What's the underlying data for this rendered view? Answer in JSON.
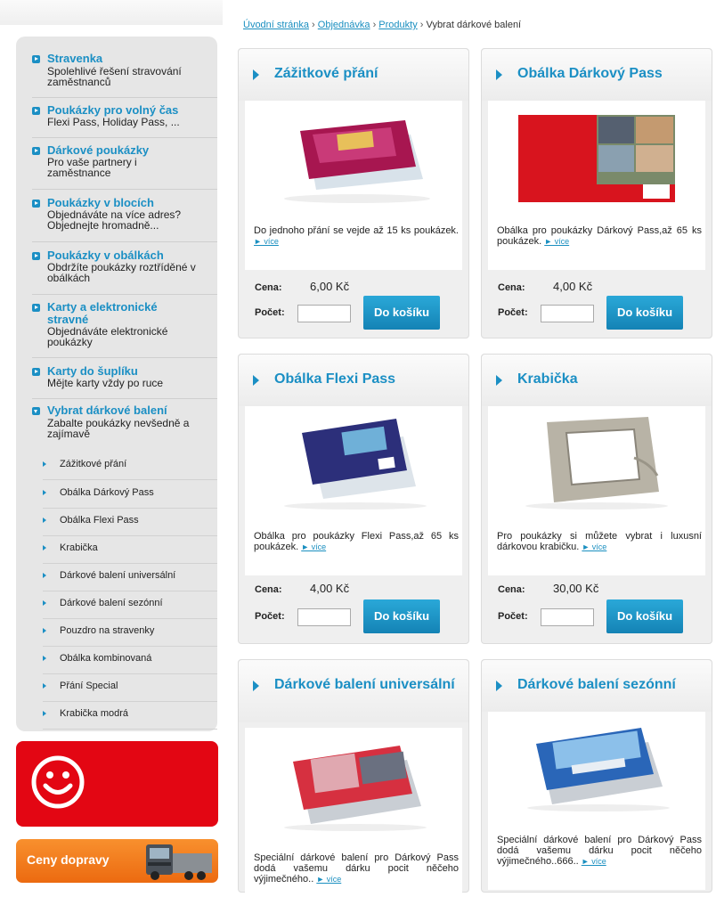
{
  "breadcrumb": {
    "home": "Úvodní stránka",
    "order": "Objednávka",
    "products": "Produkty",
    "current": "Vybrat dárkové balení",
    "sep": "›"
  },
  "sidebar": {
    "items": [
      {
        "title": "Stravenka",
        "desc": "Spolehlivé řešení stravování zaměstnanců"
      },
      {
        "title": "Poukázky pro volný čas",
        "desc": "Flexi Pass, Holiday Pass, ..."
      },
      {
        "title": "Dárkové poukázky",
        "desc": "Pro vaše partnery i zaměstnance"
      },
      {
        "title": "Poukázky v blocích",
        "desc": "Objednáváte na více adres? Objednejte hromadně..."
      },
      {
        "title": "Poukázky v obálkách",
        "desc": "Obdržíte poukázky roztříděné v obálkách"
      },
      {
        "title": "Karty a elektronické stravné",
        "desc": "Objednáváte elektronické poukázky"
      },
      {
        "title": "Karty do šuplíku",
        "desc": "Mějte karty vždy po ruce"
      },
      {
        "title": "Vybrat dárkové balení",
        "desc": "Zabalte poukázky nevšedně a zajímavě"
      }
    ],
    "subitems": [
      "Zážitkové přání",
      "Obálka Dárkový Pass",
      "Obálka Flexi Pass",
      "Krabička",
      "Dárkové balení universální",
      "Dárkové balení sezónní",
      "Pouzdro na stravenky",
      "Obálka kombinovaná",
      "Přání Special",
      "Krabička modrá"
    ],
    "shipping_label": "Ceny dopravy"
  },
  "labels": {
    "price": "Cena:",
    "qty": "Počet:",
    "add_to_cart": "Do košíku",
    "more": "► více"
  },
  "products": [
    {
      "title": "Zážitkové přání",
      "desc": "Do jednoho přání se vejde až 15 ks poukázek.",
      "price": "6,00 Kč"
    },
    {
      "title": "Obálka Dárkový Pass",
      "desc": "Obálka pro poukázky Dárkový Pass,až 65 ks poukázek.",
      "price": "4,00 Kč"
    },
    {
      "title": "Obálka Flexi Pass",
      "desc": "Obálka pro poukázky Flexi Pass,až 65 ks poukázek.",
      "price": "4,00 Kč"
    },
    {
      "title": "Krabička",
      "desc": "Pro poukázky si můžete vybrat i luxusní dárkovou krabičku.",
      "price": "30,00 Kč"
    },
    {
      "title": "Dárkové balení universální",
      "desc": "Speciální dárkové balení pro Dárkový Pass dodá vašemu dárku pocit něčeho výjimečného..",
      "price": ""
    },
    {
      "title": "Dárkové balení sezónní",
      "desc": "Speciální dárkové balení pro Dárkový Pass dodá vašemu dárku pocit něčeho výjimečného..666..",
      "price": ""
    }
  ],
  "colors": {
    "accent": "#1b8fc4",
    "red_banner": "#e30613",
    "orange_banner": "#f08020"
  }
}
